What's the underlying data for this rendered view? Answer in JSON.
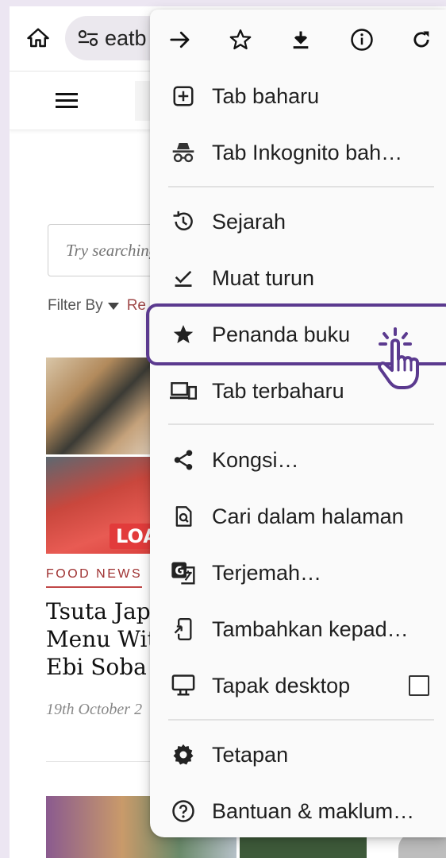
{
  "toolbar": {
    "url_text": "eatb"
  },
  "page": {
    "search_placeholder": "Try searching",
    "filter_label": "Filter By",
    "filter_extra": "Re",
    "category": "FOOD NEWS",
    "headline": "Tsuta Japa\nMenu Wit\nEbi Soba A",
    "date": "19th October 2",
    "thumb_tag": "LOA"
  },
  "menu": {
    "top_icons": [
      "forward-icon",
      "star-icon",
      "download-icon",
      "info-icon",
      "refresh-icon"
    ],
    "items": [
      {
        "label": "Tab baharu",
        "icon": "new-tab-icon"
      },
      {
        "label": "Tab Inkognito bah…",
        "icon": "incognito-icon"
      },
      {
        "label": "Sejarah",
        "icon": "history-icon"
      },
      {
        "label": "Muat turun",
        "icon": "downloads-icon"
      },
      {
        "label": "Penanda buku",
        "icon": "bookmark-star-icon"
      },
      {
        "label": "Tab terbaharu",
        "icon": "recent-tabs-icon"
      },
      {
        "label": "Kongsi…",
        "icon": "share-icon"
      },
      {
        "label": "Cari dalam halaman",
        "icon": "find-in-page-icon"
      },
      {
        "label": "Terjemah…",
        "icon": "translate-icon"
      },
      {
        "label": "Tambahkan kepad…",
        "icon": "add-to-home-icon"
      },
      {
        "label": "Tapak desktop",
        "icon": "desktop-icon"
      },
      {
        "label": "Tetapan",
        "icon": "settings-gear-icon"
      },
      {
        "label": "Bantuan & maklum…",
        "icon": "help-icon"
      }
    ],
    "highlighted_item": "Penanda buku",
    "desktop_site_checked": false
  },
  "colors": {
    "highlight": "#5b3a8f",
    "menu_bg": "#fafafa",
    "category_red": "#9e2f2f"
  }
}
